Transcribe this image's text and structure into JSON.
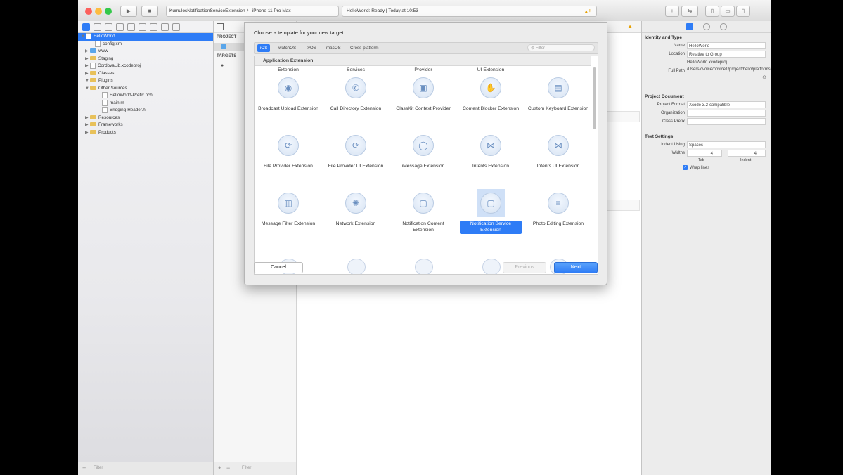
{
  "toolbar": {
    "scheme": "KumulosNotificationServiceExtension",
    "device": "iPhone 11 Pro Max",
    "status": "HelloWorld: Ready | Today at 10:53"
  },
  "navigator": {
    "items": [
      {
        "label": "HelloWorld"
      },
      {
        "label": "config.xml"
      },
      {
        "label": "www"
      },
      {
        "label": "Staging"
      },
      {
        "label": "CordovaLib.xcodeproj"
      },
      {
        "label": "Classes"
      },
      {
        "label": "Plugins"
      },
      {
        "label": "Other Sources"
      },
      {
        "label": "HelloWorld-Prefix.pch"
      },
      {
        "label": "main.m"
      },
      {
        "label": "Bridging-Header.h"
      },
      {
        "label": "Resources"
      },
      {
        "label": "Frameworks"
      },
      {
        "label": "Products"
      }
    ],
    "filter_placeholder": "Filter"
  },
  "project_list": {
    "project_header": "PROJECT",
    "targets_header": "TARGETS",
    "filter_placeholder": "Filter"
  },
  "sheet": {
    "title": "Choose a template for your new target:",
    "platforms": [
      "iOS",
      "watchOS",
      "tvOS",
      "macOS",
      "Cross-platform"
    ],
    "filter_placeholder": "Filter",
    "section": "Application Extension",
    "top_labels": [
      "Extension",
      "Services",
      "Provider",
      "UI Extension"
    ],
    "templates": [
      {
        "label": "Broadcast Upload Extension",
        "icon": "broadcast-icon"
      },
      {
        "label": "Call Directory Extension",
        "icon": "phone-icon"
      },
      {
        "label": "ClassKit Context Provider",
        "icon": "classkit-icon"
      },
      {
        "label": "Content Blocker Extension",
        "icon": "hand-icon"
      },
      {
        "label": "Custom Keyboard Extension",
        "icon": "keyboard-icon"
      },
      {
        "label": "File Provider Extension",
        "icon": "sync-icon"
      },
      {
        "label": "File Provider UI Extension",
        "icon": "sync-icon"
      },
      {
        "label": "iMessage Extension",
        "icon": "message-bubble-icon"
      },
      {
        "label": "Intents Extension",
        "icon": "intents-icon"
      },
      {
        "label": "Intents UI Extension",
        "icon": "intents-icon"
      },
      {
        "label": "Message Filter Extension",
        "icon": "trash-filter-icon"
      },
      {
        "label": "Network Extension",
        "icon": "network-icon"
      },
      {
        "label": "Notification Content Extension",
        "icon": "notification-icon"
      },
      {
        "label": "Notification Service Extension",
        "icon": "notification-icon"
      },
      {
        "label": "Photo Editing Extension",
        "icon": "sliders-icon"
      }
    ],
    "selected_index": 13,
    "cancel": "Cancel",
    "previous": "Previous",
    "next": "Next"
  },
  "inspector": {
    "identity_header": "Identity and Type",
    "name_label": "Name",
    "name_value": "HelloWorld",
    "location_label": "Location",
    "location_value": "Relative to Group",
    "location_file": "HelloWorld.xcodeproj",
    "fullpath_label": "Full Path",
    "fullpath_value": "/Users/cvolce/novice1/project/hello/platforms/ios/HelloWorld.xcodeproj",
    "project_doc_header": "Project Document",
    "format_label": "Project Format",
    "format_value": "Xcode 3.2-compatible",
    "org_label": "Organization",
    "class_prefix_label": "Class Prefix",
    "text_header": "Text Settings",
    "indent_using_label": "Indent Using",
    "indent_using_value": "Spaces",
    "widths_label": "Widths",
    "tab_width": "4",
    "indent_width": "4",
    "tab_label": "Tab",
    "indent_label": "Indent",
    "wrap_label": "Wrap lines"
  }
}
